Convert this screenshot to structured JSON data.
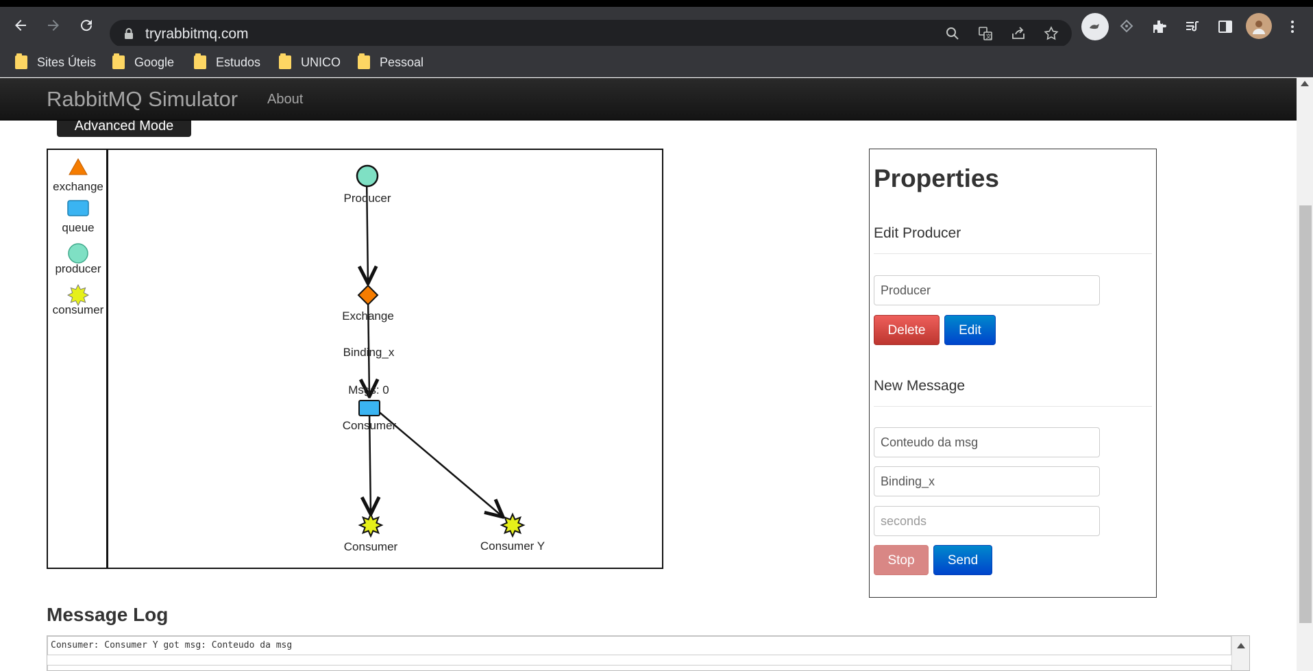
{
  "browser": {
    "url": "tryrabbitmq.com",
    "bookmarks": [
      "Sites Úteis",
      "Google",
      "Estudos",
      "UNICO",
      "Pessoal"
    ],
    "icons": [
      "back-icon",
      "forward-icon",
      "reload-icon",
      "lock-icon",
      "search-icon",
      "translate-icon",
      "share-icon",
      "star-icon",
      "extension-icon",
      "puzzle-icon",
      "media-icon",
      "sidepanel-icon",
      "profile-icon",
      "menu-icon"
    ]
  },
  "navbar": {
    "brand": "RabbitMQ Simulator",
    "about": "About"
  },
  "advanced_button": "Advanced Mode",
  "palette": {
    "exchange": "exchange",
    "queue": "queue",
    "producer": "producer",
    "consumer": "consumer"
  },
  "graph": {
    "producer": "Producer",
    "exchange": "Exchange",
    "binding": "Binding_x",
    "queue_msgs": "Msgs: 0",
    "queue": "Consumer",
    "consumer1": "Consumer",
    "consumer2": "Consumer Y"
  },
  "properties": {
    "title": "Properties",
    "edit_heading": "Edit Producer",
    "name_value": "Producer",
    "delete_label": "Delete",
    "edit_label": "Edit",
    "new_message_heading": "New Message",
    "message_value": "Conteudo da msg",
    "routing_value": "Binding_x",
    "seconds_placeholder": "seconds",
    "stop_label": "Stop",
    "send_label": "Send"
  },
  "log": {
    "title": "Message Log",
    "lines": [
      "Consumer: Consumer Y got msg:  Conteudo da msg",
      ""
    ]
  },
  "colors": {
    "exchange": "#f57c00",
    "queue": "#3ab4f2",
    "producer": "#7fe0c4",
    "consumer": "#e6f01a"
  }
}
